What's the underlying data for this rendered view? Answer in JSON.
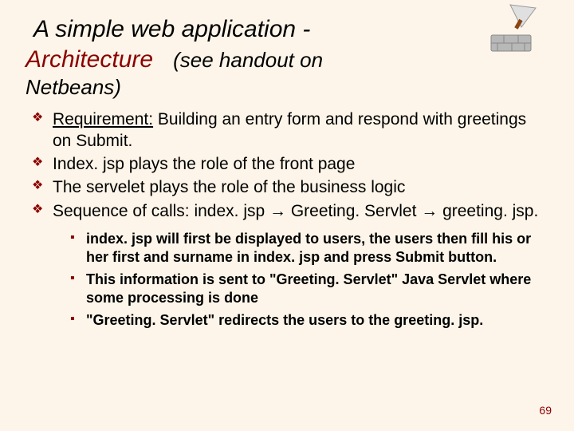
{
  "title": {
    "line1": "A simple web application -",
    "architecture": "Architecture",
    "paren": "(see handout on",
    "line3": "Netbeans)"
  },
  "bullets": [
    {
      "prefix": "Requirement:",
      "rest": "  Building an entry form and respond with greetings on Submit."
    },
    {
      "prefix": "",
      "rest": "Index. jsp plays the role of the front page"
    },
    {
      "prefix": "",
      "rest": "The servelet plays the role of the business logic"
    },
    {
      "prefix": "",
      "rest": "Sequence of calls:  index. jsp → Greeting. Servlet → greeting. jsp."
    }
  ],
  "subbullets": [
    "index. jsp will first be displayed to users, the users then fill his or her first and surname in index. jsp and press Submit button.",
    "This information is sent to \"Greeting. Servlet\" Java Servlet where some processing is done",
    "\"Greeting. Servlet\"  redirects the users to the greeting. jsp."
  ],
  "page_number": "69",
  "icon": "trowel-brick-icon"
}
